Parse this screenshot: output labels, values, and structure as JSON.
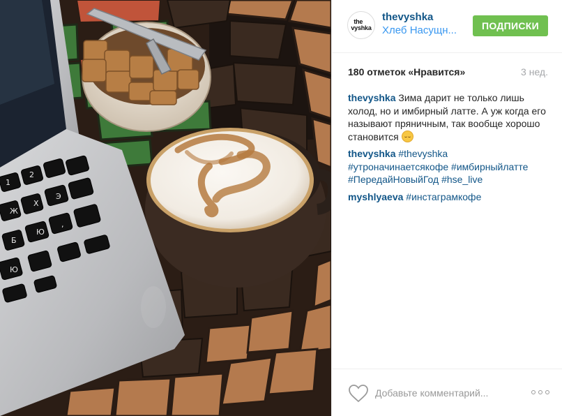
{
  "post": {
    "account": {
      "username": "thevyshka",
      "location": "Хлеб Насущн...",
      "avatar_lines": [
        "the",
        "vyshka"
      ]
    },
    "follow_label": "ПОДПИСКИ",
    "likes_text": "180 отметок «Нравится»",
    "time_ago": "3 нед.",
    "comments": [
      {
        "author": "thevyshka",
        "text": "Зима дарит не только лишь холод, но и имбирный латте. А уж когда его называют пряничным, так вообще хорошо становится"
      },
      {
        "author": "thevyshka",
        "tags": [
          "#thevyshka",
          "#утроначинаетсякофе",
          "#имбирныйлатте",
          "#ПередайНовыйГод",
          "#hse_live"
        ]
      },
      {
        "author": "myshlyaeva",
        "tags": [
          "#инстаграмкофе"
        ]
      }
    ],
    "comment_placeholder": "Добавьте комментарий...",
    "icons": {
      "like": "heart-icon",
      "more": "more-options-icon",
      "emoji": "relieved-face-emoji"
    },
    "colors": {
      "link": "#125688",
      "location": "#3897f0",
      "follow_button": "#70c050",
      "muted": "#a5a7aa"
    }
  }
}
